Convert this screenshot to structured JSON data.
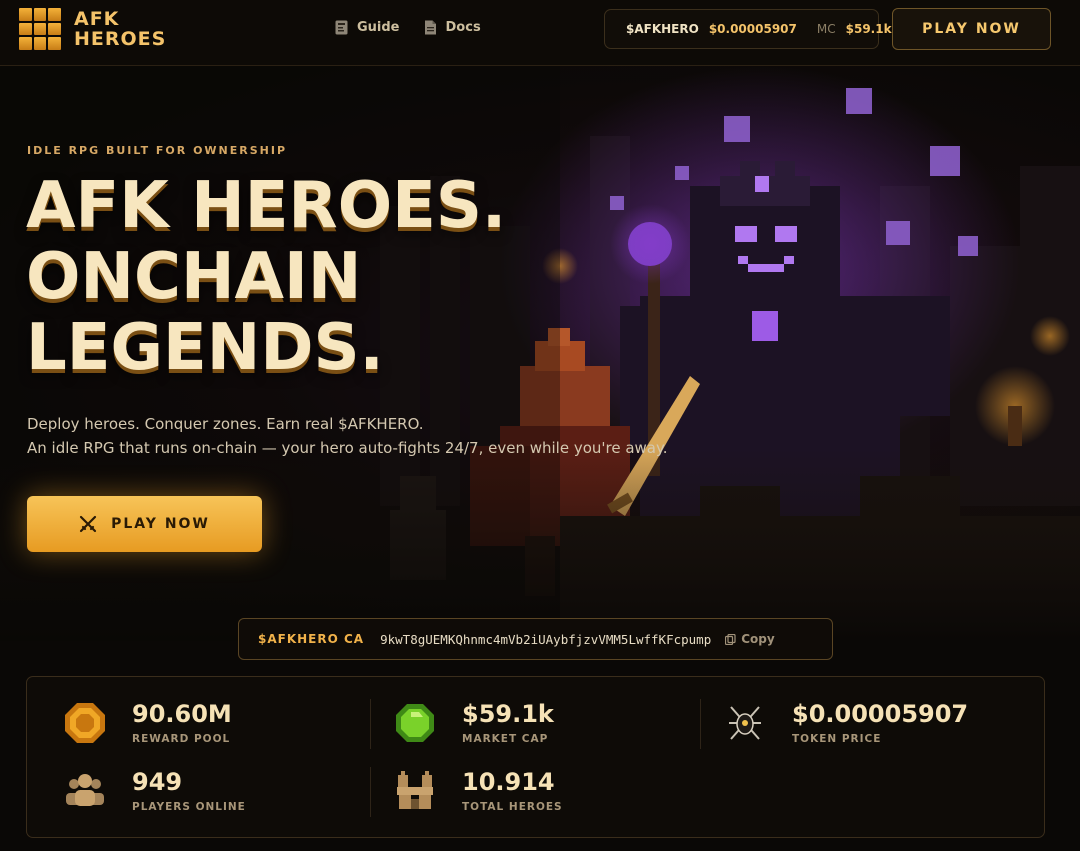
{
  "nav": {
    "logo_line1": "AFK",
    "logo_line2": "HEROES",
    "links": [
      {
        "label": "Guide",
        "icon": "book-icon"
      },
      {
        "label": "Docs",
        "icon": "document-icon"
      }
    ],
    "ticker": {
      "symbol": "$AFKHERO",
      "price": "$0.00005907",
      "mc_label": "MC",
      "mc_value": "$59.1k"
    },
    "play_label": "PLAY NOW"
  },
  "hero": {
    "eyebrow": "IDLE RPG BUILT FOR OWNERSHIP",
    "headline": [
      "AFK HEROES.",
      "ONCHAIN",
      "LEGENDS."
    ],
    "sub_line1": "Deploy heroes. Conquer zones. Earn real $AFKHERO.",
    "sub_line2": "An idle RPG that runs on-chain — your hero auto-fights 24/7, even while you're away.",
    "cta_label": "PLAY NOW"
  },
  "contract": {
    "label": "$AFKHERO CA",
    "address": "9kwT8gUEMKQhnmc4mVb2iUAybfjzvVMM5LwffKFcpump",
    "copy_label": "Copy"
  },
  "stats": [
    {
      "value": "90.60M",
      "label": "REWARD POOL",
      "icon": "gold-coin-icon"
    },
    {
      "value": "$59.1k",
      "label": "MARKET CAP",
      "icon": "green-gem-icon"
    },
    {
      "value": "$0.00005907",
      "label": "TOKEN PRICE",
      "icon": "spider-token-icon"
    },
    {
      "value": "949",
      "label": "PLAYERS ONLINE",
      "icon": "players-icon"
    },
    {
      "value": "10.914",
      "label": "TOTAL HEROES",
      "icon": "castle-icon"
    }
  ],
  "colors": {
    "accent": "#f4c36a",
    "cta_top": "#f7c458",
    "cta_bottom": "#e79b22",
    "background": "#0a0806"
  }
}
